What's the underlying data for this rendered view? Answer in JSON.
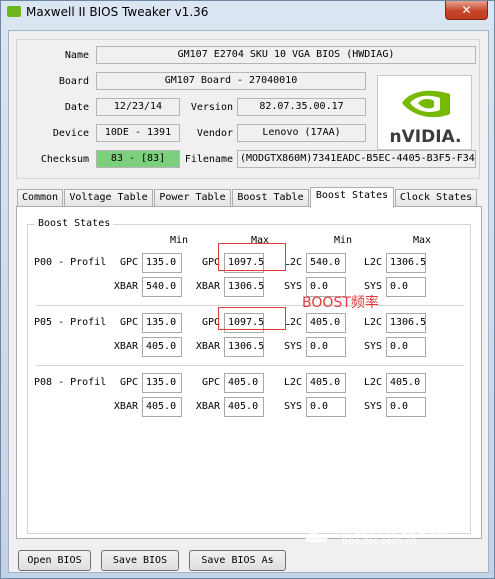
{
  "window": {
    "title": "Maxwell II BIOS Tweaker v1.36",
    "close_label": "✕"
  },
  "header": {
    "name_label": "Name",
    "name_value": "GM107 E2704 SKU 10 VGA BIOS (HWDIAG)",
    "board_label": "Board",
    "board_value": "GM107 Board - 27040010",
    "date_label": "Date",
    "date_value": "12/23/14",
    "version_label": "Version",
    "version_value": "82.07.35.00.17",
    "device_label": "Device",
    "device_value": "10DE - 1391",
    "vendor_label": "Vendor",
    "vendor_value": "Lenovo (17AA)",
    "checksum_label": "Checksum",
    "checksum_value": "83 - [83]",
    "filename_label": "Filename",
    "filename_value": "(MODGTX860M)7341EADC-B5EC-4405-B3F5-F34",
    "logo_text": "nVIDIA."
  },
  "tabs": [
    "Common",
    "Voltage Table",
    "Power Table",
    "Boost Table",
    "Boost States",
    "Clock States"
  ],
  "active_tab": "Boost States",
  "boost": {
    "group_title": "Boost States",
    "col_headers": [
      "Min",
      "Max",
      "Min",
      "Max"
    ],
    "rows": [
      {
        "name": "P00 - Profil",
        "gpc_min": "135.0",
        "gpc_max": "1097.5",
        "l2c_min": "540.0",
        "l2c_max": "1306.5",
        "xbar_min": "540.0",
        "xbar_max": "1306.5",
        "sys_min": "0.0",
        "sys_max": "0.0"
      },
      {
        "name": "P05 - Profil",
        "gpc_min": "135.0",
        "gpc_max": "1097.5",
        "l2c_min": "405.0",
        "l2c_max": "1306.5",
        "xbar_min": "405.0",
        "xbar_max": "1306.5",
        "sys_min": "0.0",
        "sys_max": "0.0"
      },
      {
        "name": "P08 - Profil",
        "gpc_min": "135.0",
        "gpc_max": "405.0",
        "l2c_min": "405.0",
        "l2c_max": "405.0",
        "xbar_min": "405.0",
        "xbar_max": "405.0",
        "sys_min": "0.0",
        "sys_max": "0.0"
      }
    ],
    "labels": {
      "gpc": "GPC",
      "xbar": "XBAR",
      "l2c": "L2C",
      "sys": "SYS"
    }
  },
  "annotation": "BOOST频率",
  "buttons": {
    "open": "Open BIOS",
    "save": "Save BIOS",
    "save_as": "Save BIOS As"
  },
  "watermark": {
    "brand": "中关村在线论坛",
    "url": "bbs.zol.com.cn"
  }
}
